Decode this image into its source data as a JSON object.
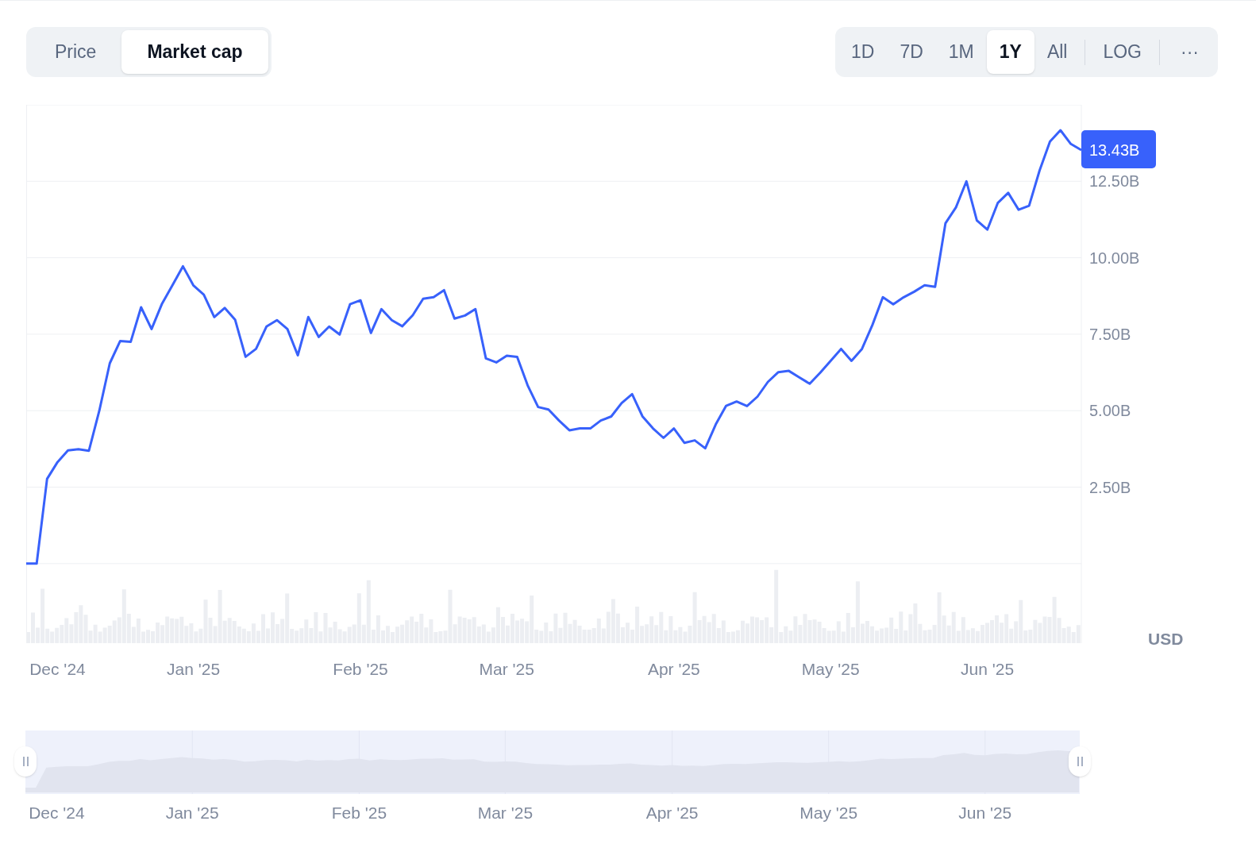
{
  "header_tabs": [
    {
      "label": "Price",
      "selected": false
    },
    {
      "label": "Market cap",
      "selected": true
    }
  ],
  "range_buttons": [
    {
      "label": "1D",
      "selected": false
    },
    {
      "label": "7D",
      "selected": false
    },
    {
      "label": "1M",
      "selected": false
    },
    {
      "label": "1Y",
      "selected": true
    },
    {
      "label": "All",
      "selected": false
    }
  ],
  "scale_button": {
    "label": "LOG",
    "selected": false
  },
  "more_button": {
    "label": "···"
  },
  "chart": {
    "current_value": "13.43B",
    "currency": "USD",
    "chart_data": {
      "type": "line",
      "ylim": [
        -2.6,
        15
      ],
      "grid": true,
      "categories": [
        null,
        null,
        null,
        "Dec '24",
        null,
        null,
        null,
        null,
        null,
        null,
        null,
        null,
        null,
        null,
        null,
        null,
        "Jan '25",
        null,
        null,
        null,
        null,
        null,
        null,
        null,
        null,
        null,
        null,
        null,
        null,
        null,
        null,
        null,
        "Feb '25",
        null,
        null,
        null,
        null,
        null,
        null,
        null,
        null,
        null,
        null,
        null,
        null,
        null,
        "Mar '25",
        null,
        null,
        null,
        null,
        null,
        null,
        null,
        null,
        null,
        null,
        null,
        null,
        null,
        null,
        null,
        "Apr '25",
        null,
        null,
        null,
        null,
        null,
        null,
        null,
        null,
        null,
        null,
        null,
        null,
        null,
        null,
        "May '25",
        null,
        null,
        null,
        null,
        null,
        null,
        null,
        null,
        null,
        null,
        null,
        null,
        null,
        null,
        "Jun '25",
        null,
        null,
        null,
        null,
        null,
        null,
        null,
        null,
        null
      ],
      "series": [
        {
          "color": "#3861fb",
          "values": [
            0,
            0,
            2.77,
            3.32,
            3.7,
            3.74,
            3.69,
            5.0,
            6.55,
            7.28,
            7.25,
            8.38,
            7.67,
            8.5,
            9.1,
            9.72,
            9.1,
            8.79,
            8.06,
            8.36,
            7.97,
            6.76,
            7.02,
            7.75,
            7.96,
            7.67,
            6.81,
            8.06,
            7.41,
            7.75,
            7.49,
            8.48,
            8.61,
            7.54,
            8.32,
            7.96,
            7.76,
            8.12,
            8.66,
            8.71,
            8.94,
            8.01,
            8.11,
            8.32,
            6.71,
            6.58,
            6.8,
            6.76,
            5.83,
            5.12,
            5.04,
            4.68,
            4.36,
            4.42,
            4.42,
            4.68,
            4.81,
            5.25,
            5.54,
            4.81,
            4.42,
            4.11,
            4.42,
            3.95,
            4.03,
            3.77,
            4.55,
            5.16,
            5.3,
            5.15,
            5.46,
            5.94,
            6.26,
            6.3,
            6.09,
            5.88,
            6.24,
            6.63,
            7.02,
            6.63,
            7.02,
            7.8,
            8.71,
            8.48,
            8.71,
            8.89,
            9.1,
            9.05,
            11.13,
            11.65,
            12.5,
            11.22,
            10.92,
            11.79,
            12.12,
            11.57,
            11.7,
            12.85,
            13.8,
            14.17,
            13.72,
            13.52
          ]
        }
      ],
      "yticks": [
        {
          "value": 2.5,
          "label": "2.50B"
        },
        {
          "value": 5,
          "label": "5.00B"
        },
        {
          "value": 7.5,
          "label": "7.50B"
        },
        {
          "value": 10,
          "label": "10.00B"
        },
        {
          "value": 12.5,
          "label": "12.50B"
        }
      ]
    }
  },
  "navigator": {
    "labels": [
      "Dec '24",
      "Jan '25",
      "Feb '25",
      "Mar '25",
      "Apr '25",
      "May '25",
      "Jun '25"
    ]
  }
}
